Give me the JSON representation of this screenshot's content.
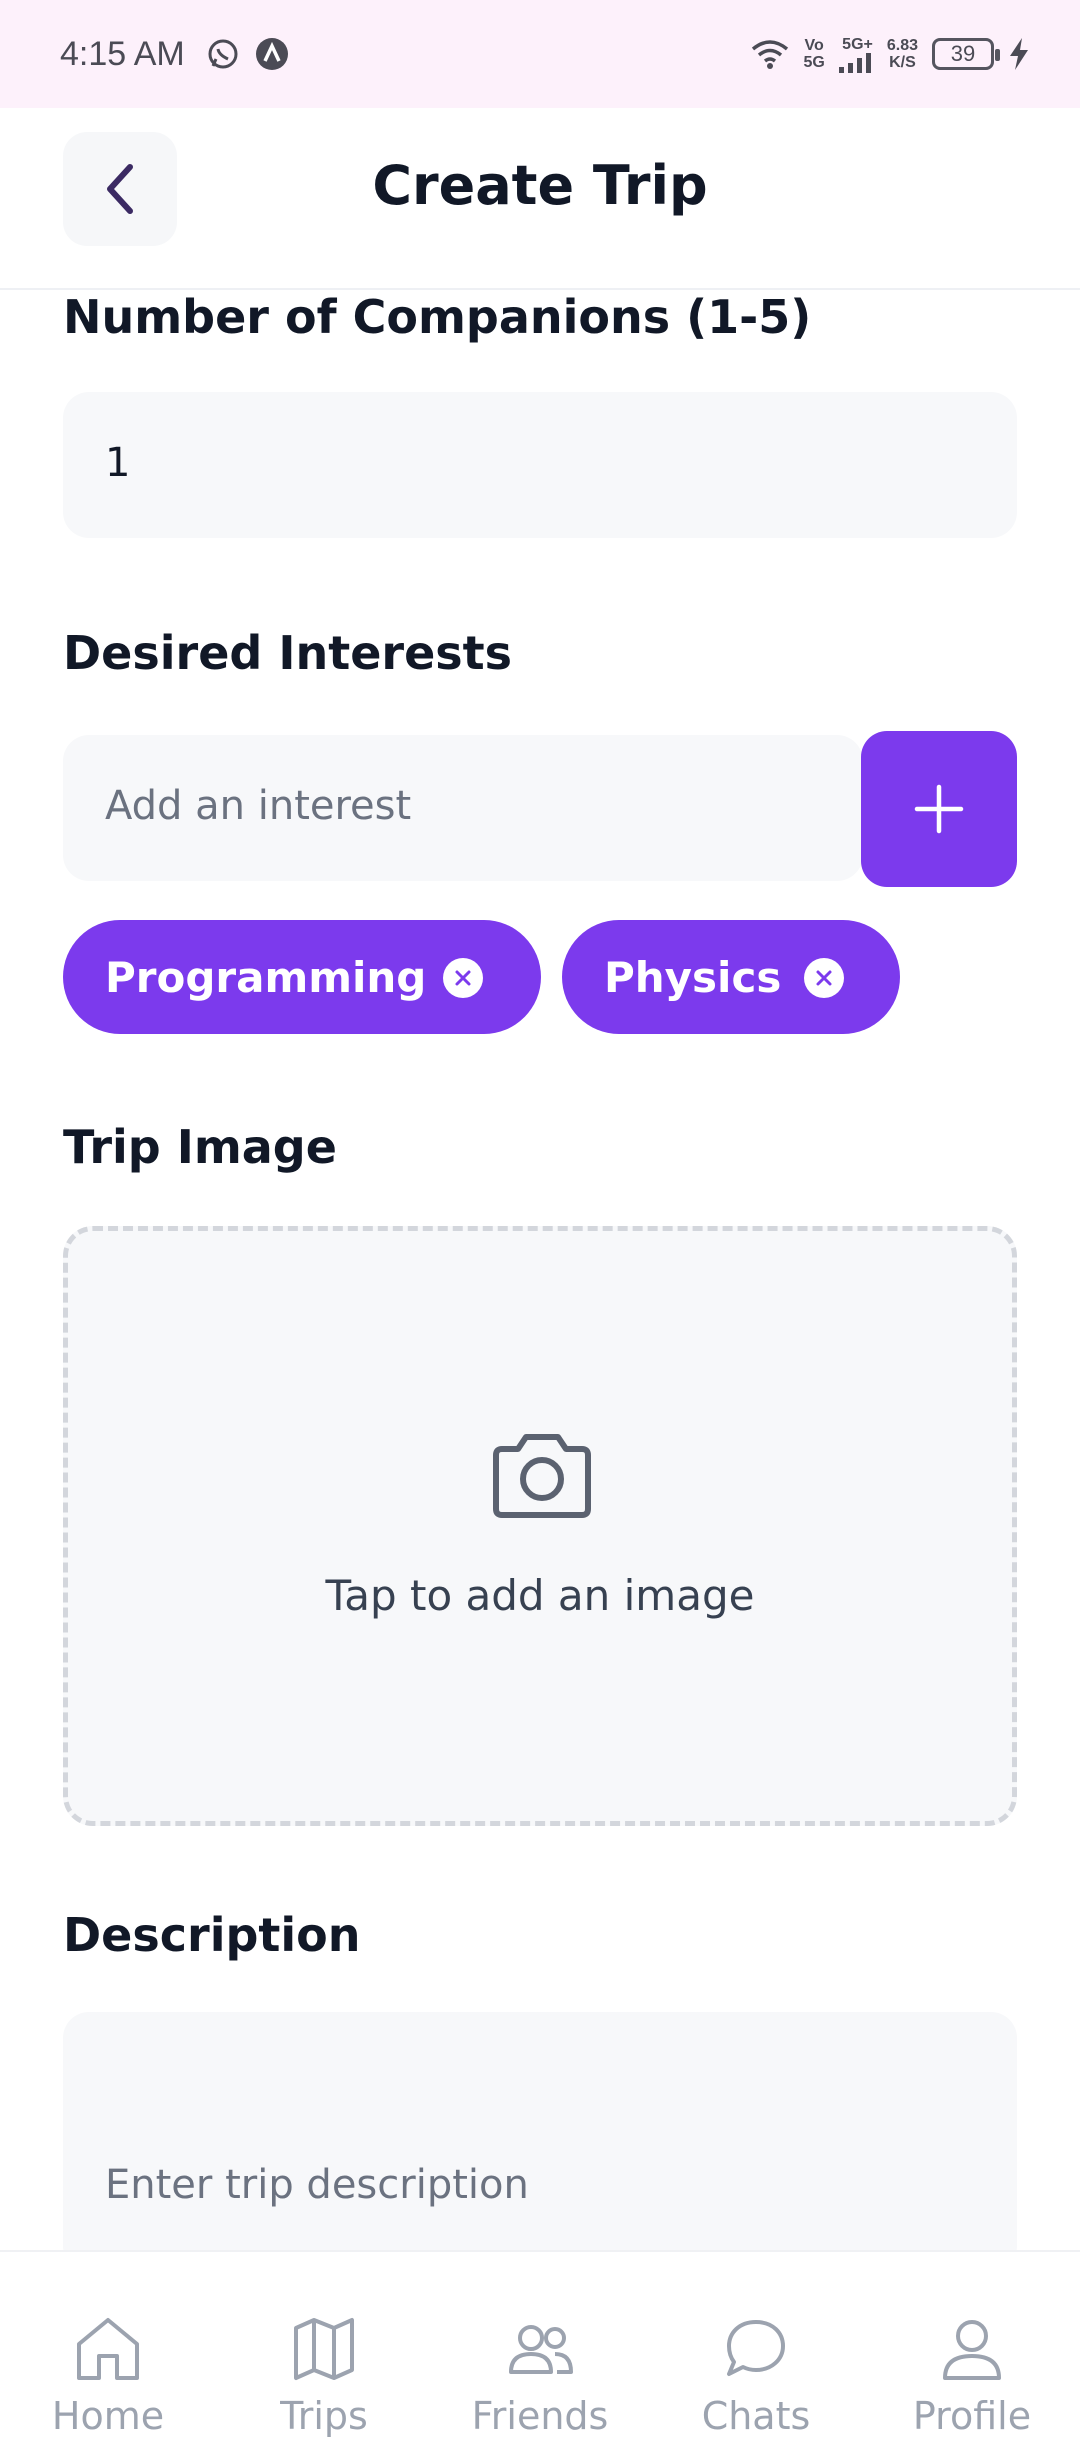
{
  "status_bar": {
    "time": "4:15 AM",
    "network_top": "Vo",
    "network_bottom": "5G",
    "signal_label": "5G+",
    "speed_value": "6.83",
    "speed_unit": "K/S",
    "battery": "39"
  },
  "header": {
    "title": "Create Trip"
  },
  "companions": {
    "label": "Number of Companions (1-5)",
    "value": "1"
  },
  "interests": {
    "label": "Desired Interests",
    "placeholder": "Add an interest",
    "tags": [
      "Programming",
      "Physics"
    ]
  },
  "trip_image": {
    "label": "Trip Image",
    "prompt": "Tap to add an image"
  },
  "description": {
    "label": "Description",
    "placeholder": "Enter trip description"
  },
  "nav": {
    "items": [
      "Home",
      "Trips",
      "Friends",
      "Chats",
      "Profile"
    ]
  },
  "colors": {
    "accent": "#7c3aed",
    "field_bg": "#f7f8fa",
    "status_bg": "#fdf1fb"
  }
}
